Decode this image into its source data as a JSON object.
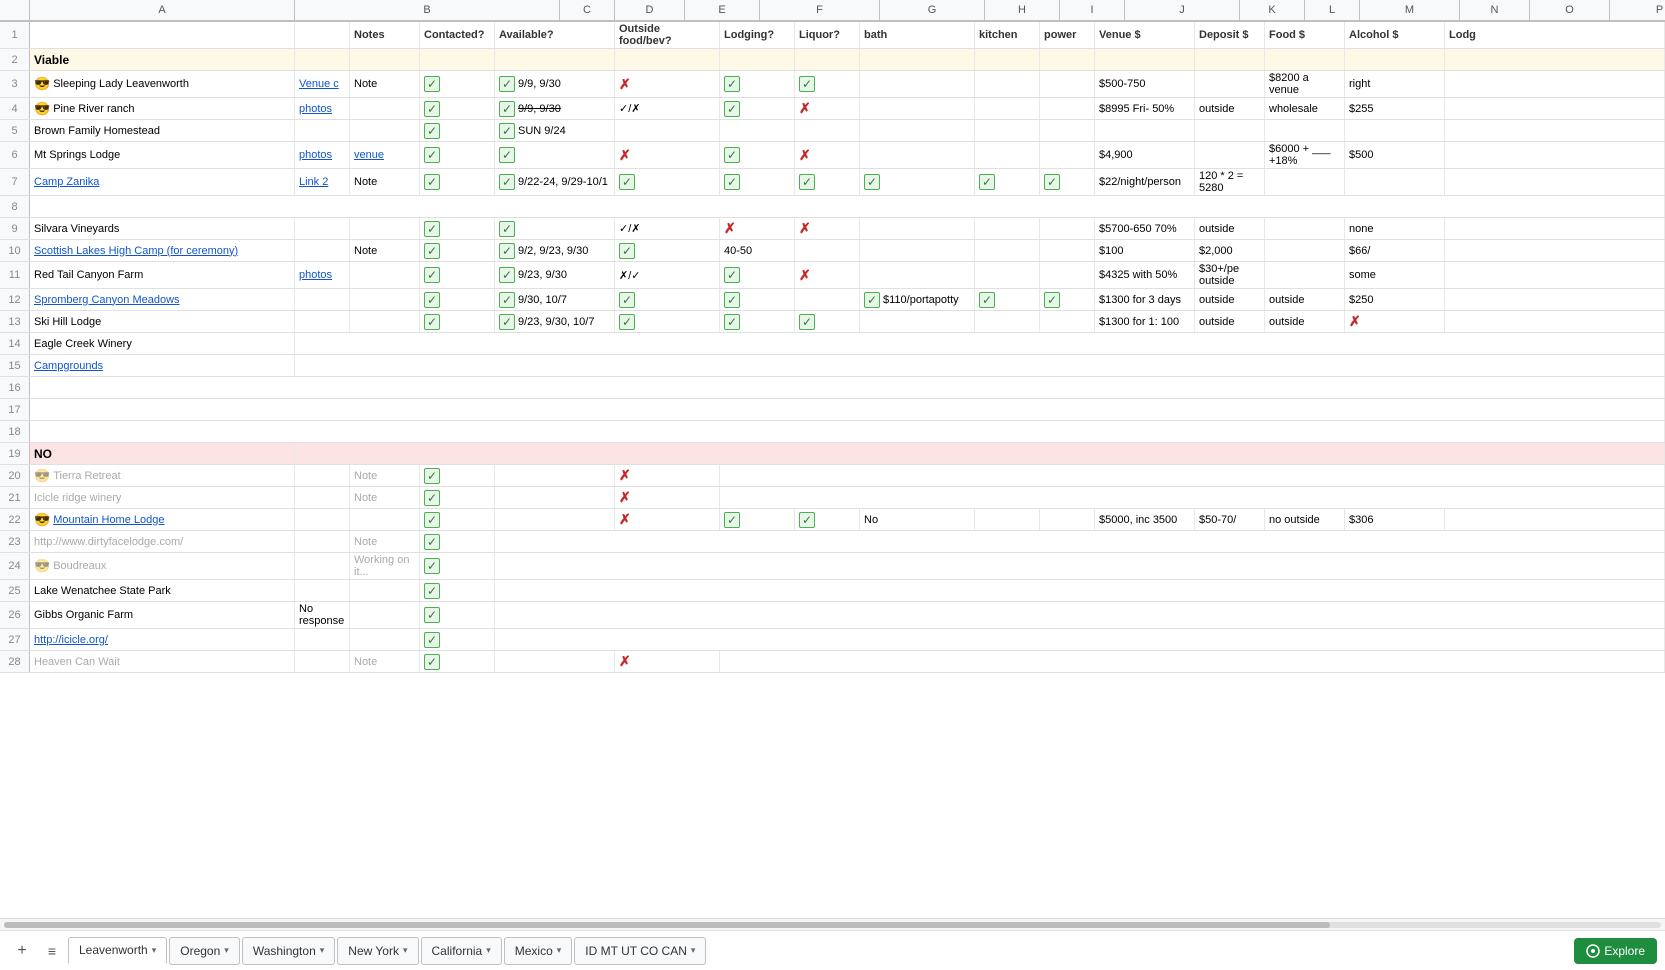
{
  "columns": {
    "letters": [
      "",
      "A",
      "B",
      "C",
      "D",
      "E",
      "F",
      "G",
      "H",
      "I",
      "J",
      "K",
      "L",
      "M",
      "N",
      "O",
      "P"
    ],
    "widths": [
      30,
      30,
      265,
      55,
      70,
      75,
      120,
      105,
      75,
      65,
      115,
      65,
      55,
      100,
      70,
      80,
      100
    ]
  },
  "header_row": {
    "labels": [
      "",
      "",
      "",
      "",
      "Notes",
      "Contacted?",
      "Available?",
      "Outside food/bev?",
      "Lodging?",
      "Liquor?",
      "bath",
      "",
      "kitchen",
      "power",
      "Venue $",
      "Deposit $",
      "Food $",
      "Alcohol $"
    ]
  },
  "rows": [
    {
      "num": 2,
      "section": "Viable",
      "bg": "header"
    },
    {
      "num": 3,
      "b": "Sleeping Lady Leavenworth",
      "emoji": "😎",
      "c": "Venue c",
      "c_link": true,
      "d": "Note",
      "e_check": true,
      "f": "✓ 9/9, 9/30",
      "g_x": true,
      "h_check": true,
      "i_check": true,
      "m": "$500-750",
      "o": "$8200 a venue",
      "p": "right"
    },
    {
      "num": 4,
      "b": "Pine River ranch",
      "emoji": "😎",
      "c": "photos",
      "c_link": true,
      "e_check": true,
      "f": "✓ 9/9, 9/30",
      "g": "✓/✗",
      "h_check": true,
      "i_x": true,
      "m": "$8995 Fri- 50%",
      "n": "outside",
      "o": "wholesale",
      "p": "$255"
    },
    {
      "num": 5,
      "b": "Brown Family Homestead",
      "e_check": true,
      "f": "✓ SUN 9/24"
    },
    {
      "num": 6,
      "b": "Mt Springs Lodge",
      "c": "photos",
      "c_link": true,
      "d": "venue",
      "d_link": true,
      "e_check": true,
      "e_check2": true,
      "g_x": true,
      "h_check": true,
      "i_x": true,
      "m": "$4,900",
      "o": "$6000 + ___ +18%",
      "p": "$500"
    },
    {
      "num": 7,
      "b": "Camp Zanika",
      "b_link": true,
      "c": "Link 2",
      "c_link": true,
      "d": "Note",
      "e_check": true,
      "f": "✓ 9/22-24, 9/29-10/1",
      "g_check": true,
      "h_check": true,
      "i_check": true,
      "j_check": true,
      "k_check": true,
      "l_check": true,
      "m": "$22/night/person",
      "n": "120 * 2 = 5280"
    },
    {
      "num": 8
    },
    {
      "num": 9,
      "b": "Silvara Vineyards",
      "e_check": true,
      "f2_check": true,
      "g": "✓/✗",
      "h_x": true,
      "i_x": true,
      "m": "$5700-650 70%",
      "n": "outside",
      "p": "none"
    },
    {
      "num": 10,
      "b": "Scottish Lakes High Camp (for ceremony)",
      "b_link": true,
      "d": "Note",
      "e_check": true,
      "f": "✓ 9/2, 9/23, 9/30",
      "g_check": true,
      "h": "40-50",
      "m": "$100",
      "n": "$2,000",
      "p": "$66/"
    },
    {
      "num": 11,
      "b": "Red Tail Canyon Farm",
      "c": "photos",
      "c_link": true,
      "e_check": true,
      "f": "✓ 9/23, 9/30",
      "g": "✗/✓",
      "h_check": true,
      "i_x": true,
      "m": "$4325 with 50%",
      "n": "$30+/pe outside",
      "p": "some"
    },
    {
      "num": 12,
      "b": "Spromberg Canyon Meadows",
      "b_link": true,
      "e_check": true,
      "f": "✓ 9/30, 10/7",
      "g_check": true,
      "h_check": true,
      "j": "✓ $110/portapotty",
      "k_check": true,
      "l_check": true,
      "m": "$1300 for 3 days",
      "n": "outside",
      "o": "outside",
      "p": "$250"
    },
    {
      "num": 13,
      "b": "Ski Hill Lodge",
      "e_check": true,
      "f": "✓ 9/23, 9/30, 10/7",
      "g_check": true,
      "h_check": true,
      "i_check": true,
      "m": "$1300 for 1: 100",
      "n": "outside",
      "o": "outside",
      "p_x": true
    },
    {
      "num": 14,
      "b": "Eagle Creek Winery"
    },
    {
      "num": 15,
      "b": "Campgrounds",
      "b_link": true
    },
    {
      "num": 16
    },
    {
      "num": 17
    },
    {
      "num": 18
    },
    {
      "num": 19,
      "section": "NO",
      "bg": "no"
    },
    {
      "num": 20,
      "b": "Tierra Retreat",
      "emoji": "😎",
      "dimmed": true,
      "d": "Note",
      "e_check": true,
      "g_x": true
    },
    {
      "num": 21,
      "b": "Icicle ridge winery",
      "dimmed": true,
      "d": "Note",
      "e_check": true,
      "g_x": true
    },
    {
      "num": 22,
      "b": "Mountain Home Lodge",
      "b_link": true,
      "emoji": "😎",
      "e_check": true,
      "g_x": true,
      "h_check": true,
      "i_check": true,
      "j": "No",
      "m": "$5000, inc 3500",
      "n": "$50-70/",
      "o": "no outside",
      "p": "$306"
    },
    {
      "num": 23,
      "b": "http://www.dirtyfacelodge.com/",
      "dimmed": true,
      "d": "Note",
      "e_check": true
    },
    {
      "num": 24,
      "b": "Boudreaux",
      "emoji": "😎",
      "dimmed": true,
      "d": "Working on it...",
      "e_check": true
    },
    {
      "num": 25,
      "b": "Lake Wenatchee State Park",
      "e_check": true
    },
    {
      "num": 26,
      "b": "Gibbs Organic Farm",
      "c": "No response",
      "e_check": true
    },
    {
      "num": 27,
      "b": "http://icicle.org/",
      "b_link": true,
      "e_check": true
    },
    {
      "num": 28,
      "b": "Heaven Can Wait",
      "dimmed": true,
      "d": "Note",
      "e_check": true,
      "g_x": true
    }
  ],
  "tabs": [
    {
      "label": "Leavenworth",
      "active": true
    },
    {
      "label": "Oregon"
    },
    {
      "label": "Washington"
    },
    {
      "label": "New York"
    },
    {
      "label": "California"
    },
    {
      "label": "Mexico"
    },
    {
      "label": "ID MT UT CO CAN"
    }
  ],
  "explore_label": "Explore"
}
